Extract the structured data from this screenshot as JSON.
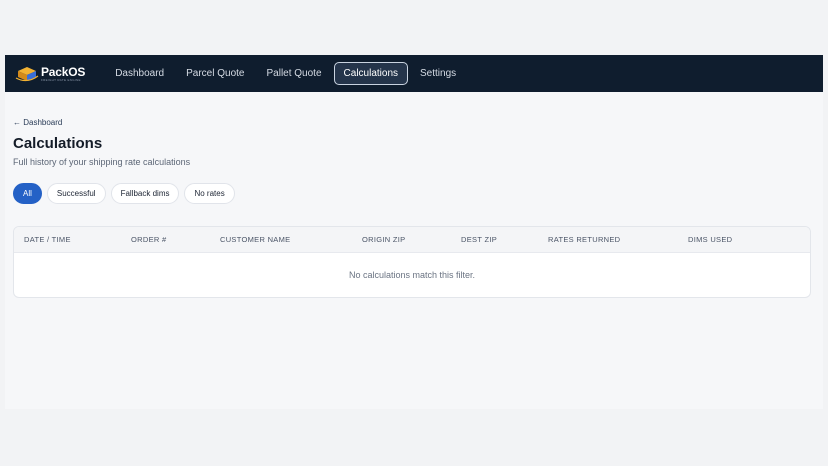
{
  "brand": {
    "name_part1": "Pack",
    "name_part2": "OS",
    "tagline": "FREIGHT RATE ENGINE"
  },
  "nav": {
    "items": [
      {
        "label": "Dashboard",
        "active": false
      },
      {
        "label": "Parcel Quote",
        "active": false
      },
      {
        "label": "Pallet Quote",
        "active": false
      },
      {
        "label": "Calculations",
        "active": true
      },
      {
        "label": "Settings",
        "active": false
      }
    ]
  },
  "breadcrumb": "← Dashboard",
  "page": {
    "title": "Calculations",
    "subtitle": "Full history of your shipping rate calculations"
  },
  "filters": [
    {
      "label": "All",
      "active": true
    },
    {
      "label": "Successful",
      "active": false
    },
    {
      "label": "Fallback dims",
      "active": false
    },
    {
      "label": "No rates",
      "active": false
    }
  ],
  "table": {
    "columns": [
      "DATE / TIME",
      "ORDER #",
      "CUSTOMER NAME",
      "ORIGIN ZIP",
      "DEST ZIP",
      "RATES RETURNED",
      "DIMS USED"
    ],
    "empty_message": "No calculations match this filter."
  },
  "colors": {
    "nav_bg": "#0f1d2e",
    "accent": "#2461c6",
    "page_bg": "#f6f7f9"
  }
}
